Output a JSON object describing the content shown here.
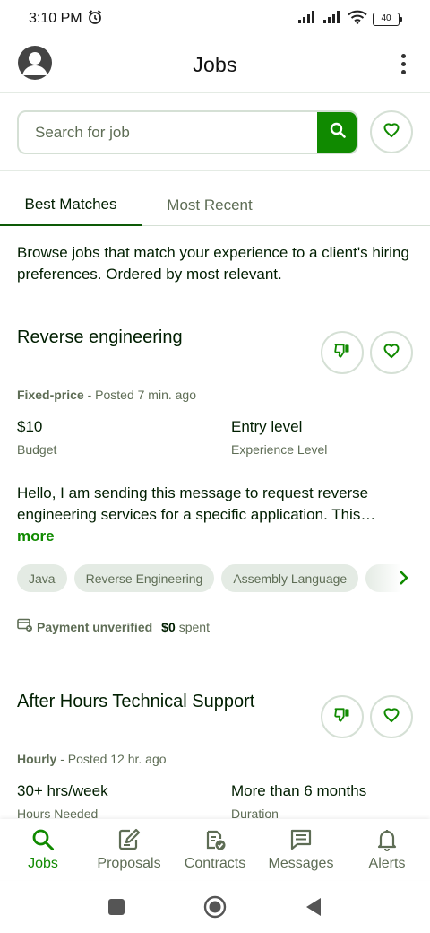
{
  "status_bar": {
    "time": "3:10 PM",
    "battery": "40",
    "icons": [
      "alarm-icon",
      "signal-icon",
      "signal-icon",
      "wifi-icon",
      "battery-icon"
    ]
  },
  "header": {
    "title": "Jobs",
    "avatar_icon": "user-avatar-icon",
    "menu_icon": "more-vertical-icon"
  },
  "search": {
    "placeholder": "Search for job",
    "value": "",
    "button_icon": "search-icon",
    "saved_icon": "heart-icon"
  },
  "tabs": [
    {
      "label": "Best Matches",
      "active": true
    },
    {
      "label": "Most Recent",
      "active": false
    }
  ],
  "feed": {
    "intro": "Browse jobs that match your experience to a client's hiring preferences. Ordered by most relevant.",
    "jobs": [
      {
        "title": "Reverse engineering",
        "type": "Fixed-price",
        "posted": " - Posted 7 min. ago",
        "stat1_value": "$10",
        "stat1_label": "Budget",
        "stat2_value": "Entry level",
        "stat2_label": "Experience Level",
        "description": "Hello, I am sending this message to request reverse engineering services for a specific application. This…",
        "more_label": "more",
        "skills": [
          "Java",
          "Reverse Engineering",
          "Assembly Language"
        ],
        "payment_status": "Payment unverified",
        "spent_amount": "$0",
        "spent_label": "spent"
      },
      {
        "title": "After Hours Technical Support",
        "type": "Hourly",
        "posted": " - Posted 12 hr. ago",
        "stat1_value": "30+ hrs/week",
        "stat1_label": "Hours Needed",
        "stat2_value": "More than 6 months",
        "stat2_label": "Duration"
      }
    ]
  },
  "bottom_nav": [
    {
      "label": "Jobs",
      "icon": "search-icon",
      "active": true
    },
    {
      "label": "Proposals",
      "icon": "edit-document-icon",
      "active": false
    },
    {
      "label": "Contracts",
      "icon": "contract-check-icon",
      "active": false
    },
    {
      "label": "Messages",
      "icon": "message-icon",
      "active": false
    },
    {
      "label": "Alerts",
      "icon": "bell-icon",
      "active": false
    }
  ],
  "colors": {
    "brand_green": "#108a00",
    "dark_text": "#001e00",
    "muted_text": "#5e6d55",
    "border": "#d5e0d5",
    "chip_bg": "#e4ebe4"
  }
}
